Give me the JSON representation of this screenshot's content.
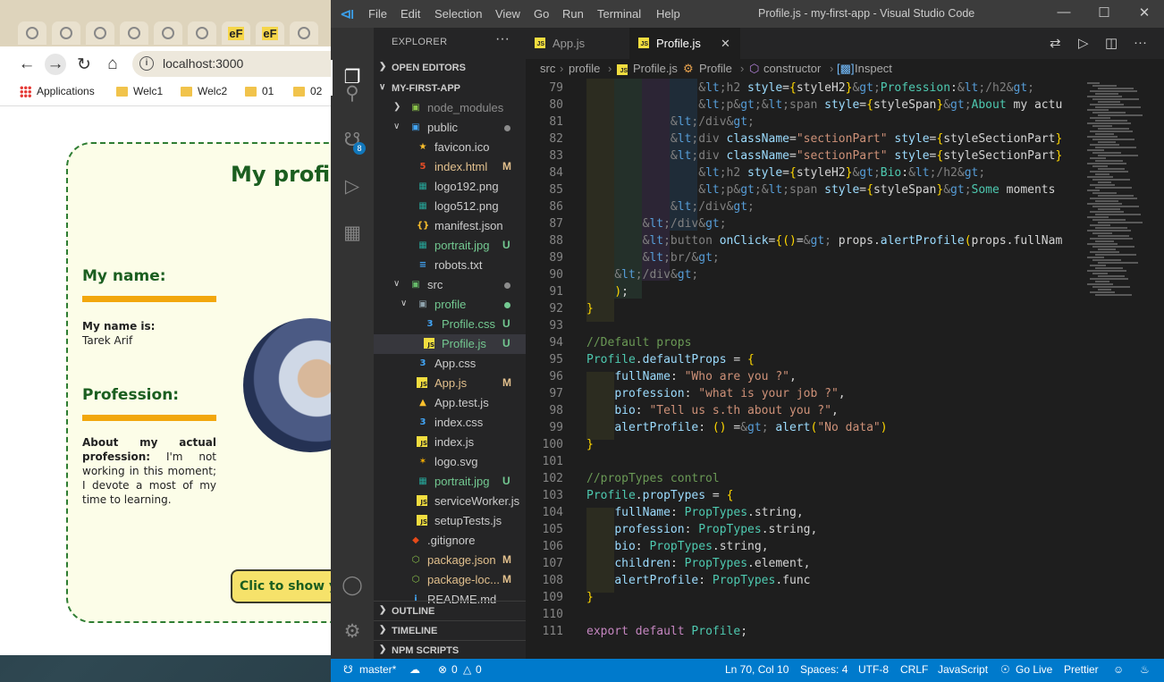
{
  "browser": {
    "url": "localhost:3000",
    "tab_icons": [
      "globe-icon",
      "globe-icon",
      "globe-icon",
      "globe-icon",
      "globe-icon",
      "globe-icon",
      "eF",
      "eF",
      "globe-icon"
    ],
    "bookmarks": [
      "Applications",
      "Welc1",
      "Welc2",
      "01",
      "02"
    ],
    "page": {
      "title": "My profile",
      "name_heading": "My name:",
      "name_label": "My name is:",
      "name_value": "Tarek Arif",
      "profession_heading": "Profession:",
      "profession_label": "About my actual profession:",
      "profession_value": "I'm not working in this moment; I devote a most of my time to learning.",
      "button_label": "Clic to show your profile"
    }
  },
  "vscode": {
    "menu": [
      "File",
      "Edit",
      "Selection",
      "View",
      "Go",
      "Run",
      "Terminal",
      "Help"
    ],
    "window_title": "Profile.js - my-first-app - Visual Studio Code",
    "scm_badge": "8",
    "explorer": {
      "title": "EXPLORER",
      "open_editors": "OPEN EDITORS",
      "project": "MY-FIRST-APP",
      "items": [
        {
          "name": "node_modules",
          "indent": 1,
          "kind": "folder-closed",
          "icon": "folder-node-icon",
          "color": "#8c8c8c",
          "status": ""
        },
        {
          "name": "public",
          "indent": 1,
          "kind": "folder-open",
          "icon": "folder-public-icon",
          "color": "#ccc",
          "status": "dot",
          "status_color": "#8c8c8c"
        },
        {
          "name": "favicon.ico",
          "indent": 2,
          "kind": "file",
          "icon": "star-icon",
          "color": "#ccc",
          "status": ""
        },
        {
          "name": "index.html",
          "indent": 2,
          "kind": "file",
          "icon": "html-icon",
          "color": "#e2c08d",
          "status": "M"
        },
        {
          "name": "logo192.png",
          "indent": 2,
          "kind": "file",
          "icon": "image-icon",
          "color": "#ccc",
          "status": ""
        },
        {
          "name": "logo512.png",
          "indent": 2,
          "kind": "file",
          "icon": "image-icon",
          "color": "#ccc",
          "status": ""
        },
        {
          "name": "manifest.json",
          "indent": 2,
          "kind": "file",
          "icon": "json-icon",
          "color": "#ccc",
          "status": ""
        },
        {
          "name": "portrait.jpg",
          "indent": 2,
          "kind": "file",
          "icon": "image-icon",
          "color": "#73c991",
          "status": "U"
        },
        {
          "name": "robots.txt",
          "indent": 2,
          "kind": "file",
          "icon": "text-icon",
          "color": "#ccc",
          "status": ""
        },
        {
          "name": "src",
          "indent": 1,
          "kind": "folder-open",
          "icon": "folder-src-icon",
          "color": "#ccc",
          "status": "dot",
          "status_color": "#8c8c8c"
        },
        {
          "name": "profile",
          "indent": 2,
          "kind": "folder-open",
          "icon": "folder-icon",
          "color": "#73c991",
          "status": "dot",
          "status_color": "#73c991"
        },
        {
          "name": "Profile.css",
          "indent": 3,
          "kind": "file",
          "icon": "css-icon",
          "color": "#73c991",
          "status": "U"
        },
        {
          "name": "Profile.js",
          "indent": 3,
          "kind": "file",
          "icon": "js-icon",
          "color": "#73c991",
          "status": "U",
          "selected": true
        },
        {
          "name": "App.css",
          "indent": 2,
          "kind": "file",
          "icon": "css-icon",
          "color": "#ccc",
          "status": ""
        },
        {
          "name": "App.js",
          "indent": 2,
          "kind": "file",
          "icon": "js-icon",
          "color": "#e2c08d",
          "status": "M"
        },
        {
          "name": "App.test.js",
          "indent": 2,
          "kind": "file",
          "icon": "test-icon",
          "color": "#ccc",
          "status": ""
        },
        {
          "name": "index.css",
          "indent": 2,
          "kind": "file",
          "icon": "css-icon",
          "color": "#ccc",
          "status": ""
        },
        {
          "name": "index.js",
          "indent": 2,
          "kind": "file",
          "icon": "js-icon",
          "color": "#ccc",
          "status": ""
        },
        {
          "name": "logo.svg",
          "indent": 2,
          "kind": "file",
          "icon": "svg-icon",
          "color": "#ccc",
          "status": ""
        },
        {
          "name": "portrait.jpg",
          "indent": 2,
          "kind": "file",
          "icon": "image-icon",
          "color": "#73c991",
          "status": "U"
        },
        {
          "name": "serviceWorker.js",
          "indent": 2,
          "kind": "file",
          "icon": "js-icon",
          "color": "#ccc",
          "status": ""
        },
        {
          "name": "setupTests.js",
          "indent": 2,
          "kind": "file",
          "icon": "js-icon",
          "color": "#ccc",
          "status": ""
        },
        {
          "name": ".gitignore",
          "indent": 1,
          "kind": "file",
          "icon": "git-icon",
          "color": "#ccc",
          "status": ""
        },
        {
          "name": "package.json",
          "indent": 1,
          "kind": "file",
          "icon": "npm-icon",
          "color": "#e2c08d",
          "status": "M"
        },
        {
          "name": "package-loc...",
          "indent": 1,
          "kind": "file",
          "icon": "npm-icon",
          "color": "#e2c08d",
          "status": "M"
        },
        {
          "name": "README.md",
          "indent": 1,
          "kind": "file",
          "icon": "info-icon",
          "color": "#ccc",
          "status": ""
        }
      ],
      "outline": "OUTLINE",
      "timeline": "TIMELINE",
      "npm_scripts": "NPM SCRIPTS"
    },
    "tabs": [
      {
        "label": "App.js",
        "active": false
      },
      {
        "label": "Profile.js",
        "active": true
      }
    ],
    "breadcrumbs": [
      "src",
      "profile",
      "Profile.js",
      "Profile",
      "constructor",
      "Inspect"
    ],
    "code": [
      {
        "n": "79",
        "t": "                <h2 style={styleH2}>Profession:</h2>"
      },
      {
        "n": "80",
        "t": "                <p><span style={styleSpan}>About my actual professio"
      },
      {
        "n": "81",
        "t": "            </div>"
      },
      {
        "n": "82",
        "t": "            <div className=\"sectionPart\" style={styleSectionPart}>{p"
      },
      {
        "n": "83",
        "t": "            <div className=\"sectionPart\" style={styleSectionPart}>"
      },
      {
        "n": "84",
        "t": "                <h2 style={styleH2}>Bio:</h2>"
      },
      {
        "n": "85",
        "t": "                <p><span style={styleSpan}>Some moments in my live:<"
      },
      {
        "n": "86",
        "t": "            </div>"
      },
      {
        "n": "87",
        "t": "        </div>"
      },
      {
        "n": "88",
        "t": "        <button onClick={()=> props.alertProfile(props.fullName)} st"
      },
      {
        "n": "89",
        "t": "        <br/>"
      },
      {
        "n": "90",
        "t": "    </div>"
      },
      {
        "n": "91",
        "t": "    );"
      },
      {
        "n": "92",
        "t": "}"
      },
      {
        "n": "93",
        "t": ""
      },
      {
        "n": "94",
        "t": "//Default props"
      },
      {
        "n": "95",
        "t": "Profile.defaultProps = {"
      },
      {
        "n": "96",
        "t": "    fullName: \"Who are you ?\","
      },
      {
        "n": "97",
        "t": "    profession: \"what is your job ?\","
      },
      {
        "n": "98",
        "t": "    bio: \"Tell us s.th about you ?\","
      },
      {
        "n": "99",
        "t": "    alertProfile: () => alert(\"No data\")"
      },
      {
        "n": "100",
        "t": "}"
      },
      {
        "n": "101",
        "t": ""
      },
      {
        "n": "102",
        "t": "//propTypes control"
      },
      {
        "n": "103",
        "t": "Profile.propTypes = {"
      },
      {
        "n": "104",
        "t": "    fullName: PropTypes.string,"
      },
      {
        "n": "105",
        "t": "    profession: PropTypes.string,"
      },
      {
        "n": "106",
        "t": "    bio: PropTypes.string,"
      },
      {
        "n": "107",
        "t": "    children: PropTypes.element,"
      },
      {
        "n": "108",
        "t": "    alertProfile: PropTypes.func"
      },
      {
        "n": "109",
        "t": "}"
      },
      {
        "n": "110",
        "t": ""
      },
      {
        "n": "111",
        "t": "export default Profile;"
      }
    ],
    "status": {
      "branch": "master*",
      "errors": "0",
      "warnings": "0",
      "position": "Ln 70, Col 10",
      "spaces": "Spaces: 4",
      "encoding": "UTF-8",
      "eol": "CRLF",
      "language": "JavaScript",
      "go_live": "Go Live",
      "prettier": "Prettier"
    }
  }
}
